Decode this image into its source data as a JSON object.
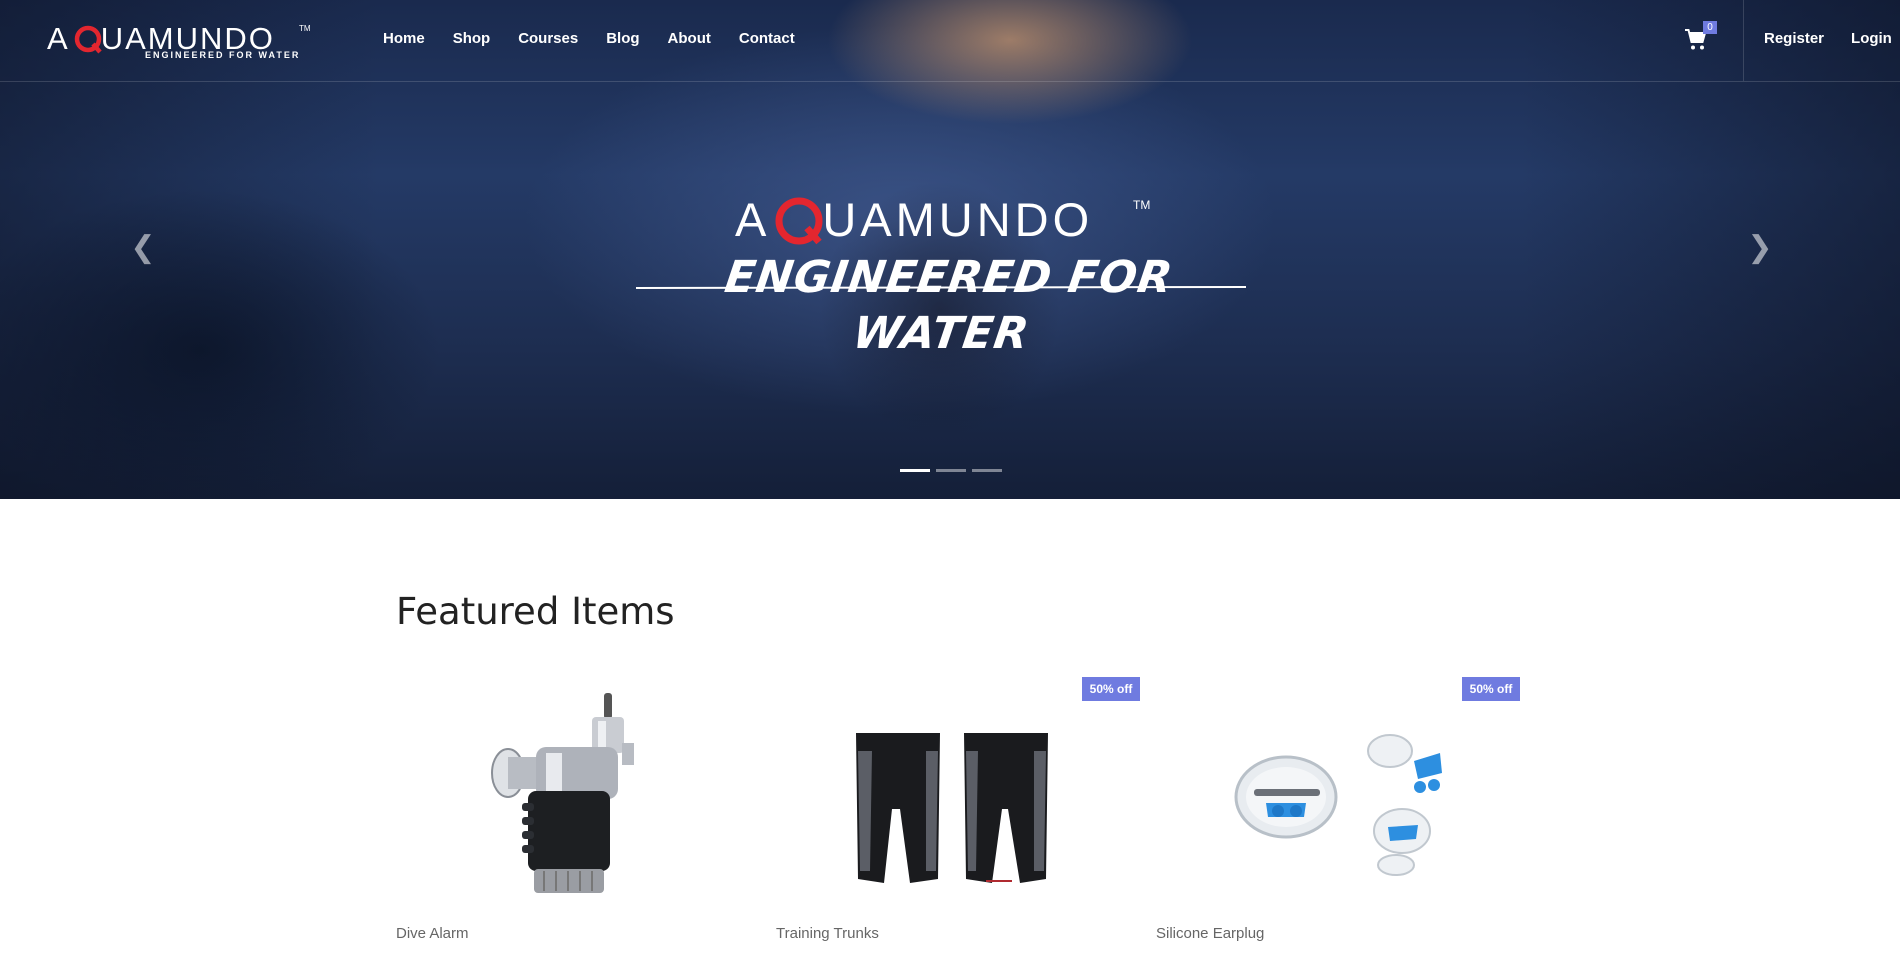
{
  "brand": {
    "name_prefix": "A",
    "name_rest": "UAMUNDO",
    "tm": "TM",
    "tagline_small": "ENGINEERED FOR WATER"
  },
  "nav": {
    "links": [
      "Home",
      "Shop",
      "Courses",
      "Blog",
      "About",
      "Contact"
    ],
    "cart_count": "0",
    "register": "Register",
    "login": "Login"
  },
  "hero": {
    "logo_prefix": "A",
    "logo_rest": "UAMUNDO",
    "logo_tm": "TM",
    "tagline": "ENGINEERED FOR WATER",
    "prev_symbol": "❮",
    "next_symbol": "❯",
    "slides_count": 3,
    "active_slide": 1
  },
  "featured": {
    "title": "Featured Items",
    "products": [
      {
        "name": "Dive Alarm",
        "badge": ""
      },
      {
        "name": "Training Trunks",
        "badge": "50% off"
      },
      {
        "name": "Silicone Earplug",
        "badge": "50% off"
      }
    ]
  },
  "colors": {
    "accent": "#6f7be0",
    "logo_red": "#e3262f",
    "earplug_blue": "#2d8fe0"
  }
}
